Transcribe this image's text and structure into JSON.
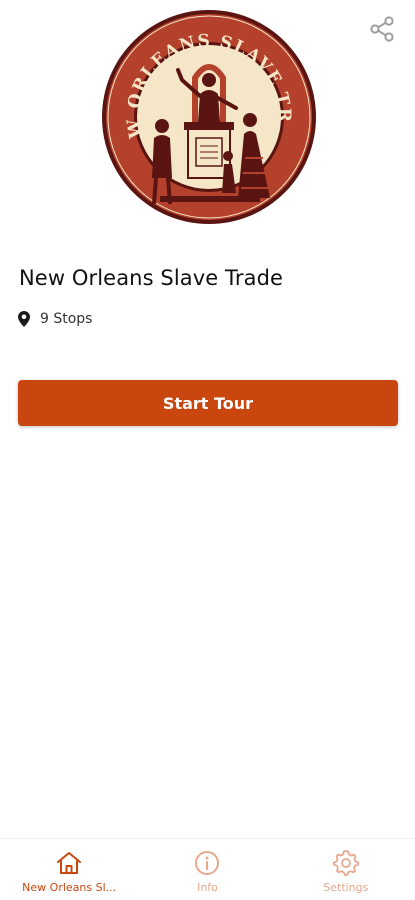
{
  "colors": {
    "accent": "#c9470f",
    "accent_light": "#e7a88e",
    "logo_red": "#b4412b",
    "logo_cream": "#f6e6c8",
    "logo_dark": "#5a1512"
  },
  "header": {
    "share_icon": "share-icon"
  },
  "logo": {
    "ring_text": "NEW ORLEANS SLAVE TRADE"
  },
  "tour": {
    "title": "New Orleans Slave Trade",
    "stops_icon": "map-pin-icon",
    "stops_label": "9 Stops",
    "start_label": "Start Tour"
  },
  "bottom_nav": {
    "items": [
      {
        "label": "New Orleans Sl...",
        "icon": "home-icon",
        "active": true
      },
      {
        "label": "Info",
        "icon": "info-icon",
        "active": false
      },
      {
        "label": "Settings",
        "icon": "gear-icon",
        "active": false
      }
    ]
  }
}
